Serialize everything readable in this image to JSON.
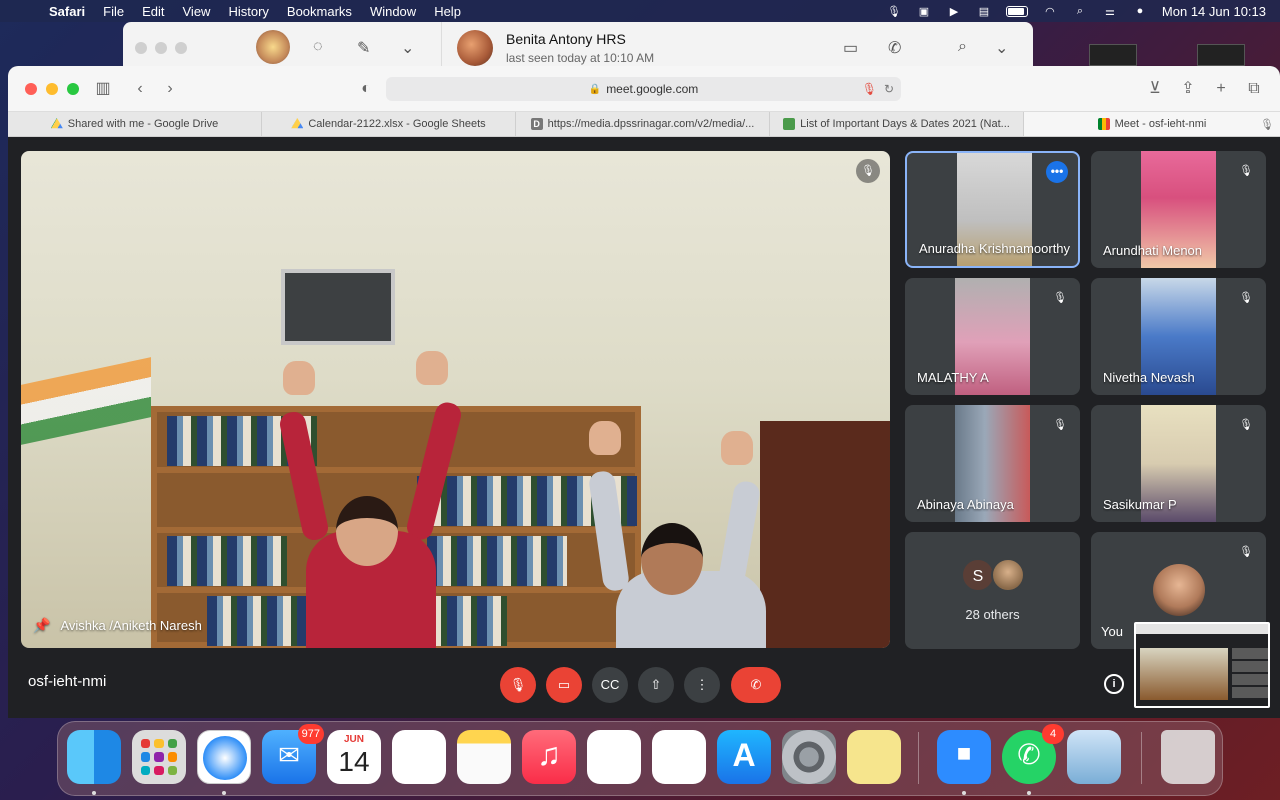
{
  "menubar": {
    "app_name": "Safari",
    "items": [
      "File",
      "Edit",
      "View",
      "History",
      "Bookmarks",
      "Window",
      "Help"
    ],
    "clock": "Mon 14 Jun  10:13"
  },
  "whatsapp": {
    "contact_name": "Benita Antony HRS",
    "contact_status": "last seen today at 10:10 AM"
  },
  "safari": {
    "url": "meet.google.com",
    "tabs": [
      {
        "label": "Shared with me - Google Drive",
        "icon": "google-drive-icon"
      },
      {
        "label": "Calendar-2122.xlsx - Google Sheets",
        "icon": "google-sheets-icon"
      },
      {
        "label": "https://media.dpssrinagar.com/v2/media/...",
        "icon": "d-letter-icon"
      },
      {
        "label": "List of Important Days & Dates 2021 (Nat...",
        "icon": "list-icon"
      },
      {
        "label": "Meet - osf-ieht-nmi",
        "icon": "google-meet-icon"
      }
    ]
  },
  "meet": {
    "main_speaker_name": "Avishka /Aniketh Naresh",
    "participants": [
      {
        "name": "Anuradha Krishnamoorthy"
      },
      {
        "name": "Arundhati Menon"
      },
      {
        "name": "MALATHY A"
      },
      {
        "name": "Nivetha Nevash"
      },
      {
        "name": "Abinaya Abinaya"
      },
      {
        "name": "Sasikumar P"
      }
    ],
    "others": {
      "initial": "S",
      "label": "28 others"
    },
    "you_label": "You",
    "meeting_code": "osf-ieht-nmi"
  },
  "dock": {
    "mail_badge": "977",
    "calendar_month": "JUN",
    "calendar_day": "14",
    "whatsapp_badge": "4"
  }
}
